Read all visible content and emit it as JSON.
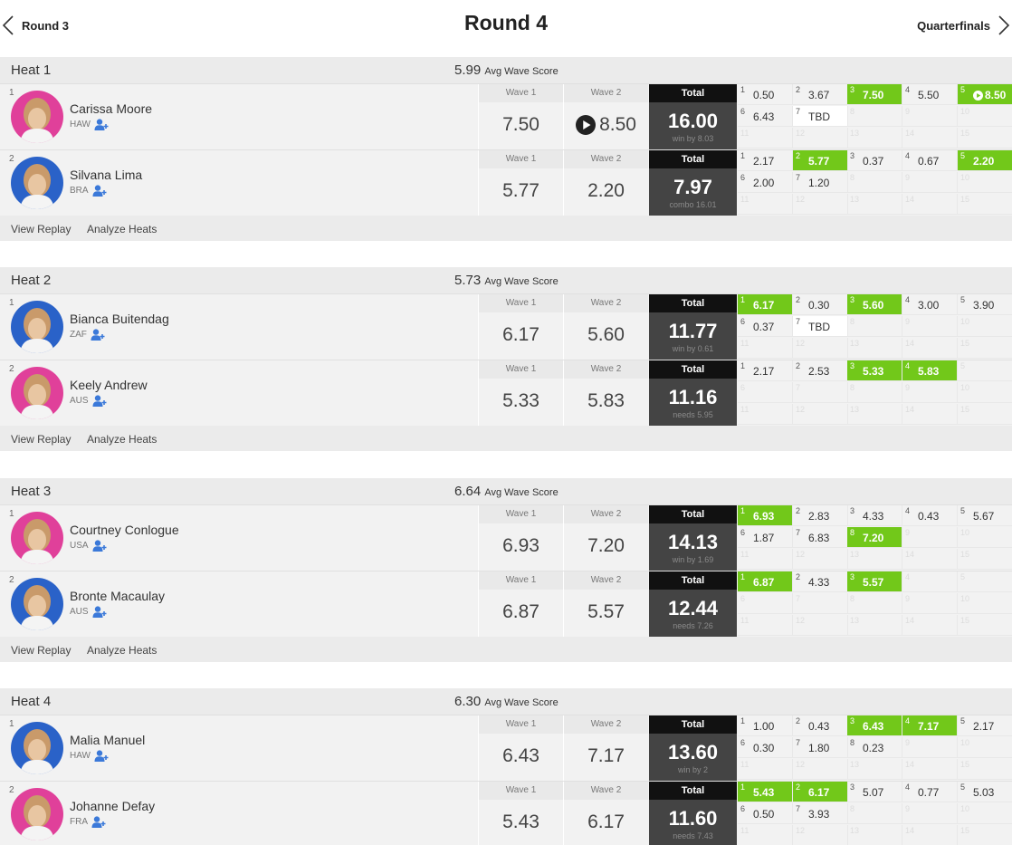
{
  "nav": {
    "prev_label": "Round 3",
    "title": "Round 4",
    "next_label": "Quarterfinals"
  },
  "labels": {
    "wave1": "Wave 1",
    "wave2": "Wave 2",
    "total": "Total",
    "avg_suffix": "Avg Wave Score",
    "view_replay": "View Replay",
    "analyze_heats": "Analyze Heats"
  },
  "colors": {
    "highlight": "#72c81a",
    "total_bg": "#444444",
    "avatar_pink": "#e0409a",
    "avatar_blue": "#2a62c8"
  },
  "heats": [
    {
      "name": "Heat 1",
      "avg": "5.99",
      "surfers": [
        {
          "seed": "1",
          "name": "Carissa Moore",
          "country": "HAW",
          "avatar_color": "pink",
          "wave1": "7.50",
          "wave2": "8.50",
          "wave2_play": true,
          "total": "16.00",
          "sub": "win by 8.03",
          "waves": [
            {
              "n": "1",
              "v": "0.50"
            },
            {
              "n": "2",
              "v": "3.67"
            },
            {
              "n": "3",
              "v": "7.50",
              "hi": true
            },
            {
              "n": "4",
              "v": "5.50"
            },
            {
              "n": "5",
              "v": "8.50",
              "hi": true,
              "play": true
            },
            {
              "n": "6",
              "v": "6.43"
            },
            {
              "n": "7",
              "v": "TBD",
              "tbd": true
            },
            {
              "n": "8",
              "v": "",
              "ghost": true
            },
            {
              "n": "9",
              "v": "",
              "ghost": true
            },
            {
              "n": "10",
              "v": "",
              "ghost": true
            },
            {
              "n": "11",
              "v": "",
              "ghost": true
            },
            {
              "n": "12",
              "v": "",
              "ghost": true
            },
            {
              "n": "13",
              "v": "",
              "ghost": true
            },
            {
              "n": "14",
              "v": "",
              "ghost": true
            },
            {
              "n": "15",
              "v": "",
              "ghost": true
            }
          ]
        },
        {
          "seed": "2",
          "name": "Silvana Lima",
          "country": "BRA",
          "avatar_color": "blue",
          "wave1": "5.77",
          "wave2": "2.20",
          "wave2_play": false,
          "total": "7.97",
          "sub": "combo 16.01",
          "waves": [
            {
              "n": "1",
              "v": "2.17"
            },
            {
              "n": "2",
              "v": "5.77",
              "hi": true
            },
            {
              "n": "3",
              "v": "0.37"
            },
            {
              "n": "4",
              "v": "0.67"
            },
            {
              "n": "5",
              "v": "2.20",
              "hi": true
            },
            {
              "n": "6",
              "v": "2.00"
            },
            {
              "n": "7",
              "v": "1.20"
            },
            {
              "n": "8",
              "v": "",
              "ghost": true
            },
            {
              "n": "9",
              "v": "",
              "ghost": true
            },
            {
              "n": "10",
              "v": "",
              "ghost": true
            },
            {
              "n": "11",
              "v": "",
              "ghost": true
            },
            {
              "n": "12",
              "v": "",
              "ghost": true
            },
            {
              "n": "13",
              "v": "",
              "ghost": true
            },
            {
              "n": "14",
              "v": "",
              "ghost": true
            },
            {
              "n": "15",
              "v": "",
              "ghost": true
            }
          ]
        }
      ]
    },
    {
      "name": "Heat 2",
      "avg": "5.73",
      "surfers": [
        {
          "seed": "1",
          "name": "Bianca Buitendag",
          "country": "ZAF",
          "avatar_color": "blue",
          "wave1": "6.17",
          "wave2": "5.60",
          "wave2_play": false,
          "total": "11.77",
          "sub": "win by 0.61",
          "waves": [
            {
              "n": "1",
              "v": "6.17",
              "hi": true
            },
            {
              "n": "2",
              "v": "0.30"
            },
            {
              "n": "3",
              "v": "5.60",
              "hi": true
            },
            {
              "n": "4",
              "v": "3.00"
            },
            {
              "n": "5",
              "v": "3.90"
            },
            {
              "n": "6",
              "v": "0.37"
            },
            {
              "n": "7",
              "v": "TBD",
              "tbd": true
            },
            {
              "n": "8",
              "v": "",
              "ghost": true
            },
            {
              "n": "9",
              "v": "",
              "ghost": true
            },
            {
              "n": "10",
              "v": "",
              "ghost": true
            },
            {
              "n": "11",
              "v": "",
              "ghost": true
            },
            {
              "n": "12",
              "v": "",
              "ghost": true
            },
            {
              "n": "13",
              "v": "",
              "ghost": true
            },
            {
              "n": "14",
              "v": "",
              "ghost": true
            },
            {
              "n": "15",
              "v": "",
              "ghost": true
            }
          ]
        },
        {
          "seed": "2",
          "name": "Keely Andrew",
          "country": "AUS",
          "avatar_color": "pink",
          "wave1": "5.33",
          "wave2": "5.83",
          "wave2_play": false,
          "total": "11.16",
          "sub": "needs 5.95",
          "waves": [
            {
              "n": "1",
              "v": "2.17"
            },
            {
              "n": "2",
              "v": "2.53"
            },
            {
              "n": "3",
              "v": "5.33",
              "hi": true
            },
            {
              "n": "4",
              "v": "5.83",
              "hi": true
            },
            {
              "n": "5",
              "v": "",
              "ghost": true
            },
            {
              "n": "6",
              "v": "",
              "ghost": true
            },
            {
              "n": "7",
              "v": "",
              "ghost": true
            },
            {
              "n": "8",
              "v": "",
              "ghost": true
            },
            {
              "n": "9",
              "v": "",
              "ghost": true
            },
            {
              "n": "10",
              "v": "",
              "ghost": true
            },
            {
              "n": "11",
              "v": "",
              "ghost": true
            },
            {
              "n": "12",
              "v": "",
              "ghost": true
            },
            {
              "n": "13",
              "v": "",
              "ghost": true
            },
            {
              "n": "14",
              "v": "",
              "ghost": true
            },
            {
              "n": "15",
              "v": "",
              "ghost": true
            }
          ]
        }
      ]
    },
    {
      "name": "Heat 3",
      "avg": "6.64",
      "surfers": [
        {
          "seed": "1",
          "name": "Courtney Conlogue",
          "country": "USA",
          "avatar_color": "pink",
          "wave1": "6.93",
          "wave2": "7.20",
          "wave2_play": false,
          "total": "14.13",
          "sub": "win by 1.69",
          "waves": [
            {
              "n": "1",
              "v": "6.93",
              "hi": true
            },
            {
              "n": "2",
              "v": "2.83"
            },
            {
              "n": "3",
              "v": "4.33"
            },
            {
              "n": "4",
              "v": "0.43"
            },
            {
              "n": "5",
              "v": "5.67"
            },
            {
              "n": "6",
              "v": "1.87"
            },
            {
              "n": "7",
              "v": "6.83"
            },
            {
              "n": "8",
              "v": "7.20",
              "hi": true
            },
            {
              "n": "9",
              "v": "",
              "ghost": true
            },
            {
              "n": "10",
              "v": "",
              "ghost": true
            },
            {
              "n": "11",
              "v": "",
              "ghost": true
            },
            {
              "n": "12",
              "v": "",
              "ghost": true
            },
            {
              "n": "13",
              "v": "",
              "ghost": true
            },
            {
              "n": "14",
              "v": "",
              "ghost": true
            },
            {
              "n": "15",
              "v": "",
              "ghost": true
            }
          ]
        },
        {
          "seed": "2",
          "name": "Bronte Macaulay",
          "country": "AUS",
          "avatar_color": "blue",
          "wave1": "6.87",
          "wave2": "5.57",
          "wave2_play": false,
          "total": "12.44",
          "sub": "needs 7.26",
          "waves": [
            {
              "n": "1",
              "v": "6.87",
              "hi": true
            },
            {
              "n": "2",
              "v": "4.33"
            },
            {
              "n": "3",
              "v": "5.57",
              "hi": true
            },
            {
              "n": "4",
              "v": "",
              "ghost": true
            },
            {
              "n": "5",
              "v": "",
              "ghost": true
            },
            {
              "n": "6",
              "v": "",
              "ghost": true
            },
            {
              "n": "7",
              "v": "",
              "ghost": true
            },
            {
              "n": "8",
              "v": "",
              "ghost": true
            },
            {
              "n": "9",
              "v": "",
              "ghost": true
            },
            {
              "n": "10",
              "v": "",
              "ghost": true
            },
            {
              "n": "11",
              "v": "",
              "ghost": true
            },
            {
              "n": "12",
              "v": "",
              "ghost": true
            },
            {
              "n": "13",
              "v": "",
              "ghost": true
            },
            {
              "n": "14",
              "v": "",
              "ghost": true
            },
            {
              "n": "15",
              "v": "",
              "ghost": true
            }
          ]
        }
      ]
    },
    {
      "name": "Heat 4",
      "avg": "6.30",
      "surfers": [
        {
          "seed": "1",
          "name": "Malia Manuel",
          "country": "HAW",
          "avatar_color": "blue",
          "wave1": "6.43",
          "wave2": "7.17",
          "wave2_play": false,
          "total": "13.60",
          "sub": "win by 2",
          "waves": [
            {
              "n": "1",
              "v": "1.00"
            },
            {
              "n": "2",
              "v": "0.43"
            },
            {
              "n": "3",
              "v": "6.43",
              "hi": true
            },
            {
              "n": "4",
              "v": "7.17",
              "hi": true
            },
            {
              "n": "5",
              "v": "2.17"
            },
            {
              "n": "6",
              "v": "0.30"
            },
            {
              "n": "7",
              "v": "1.80"
            },
            {
              "n": "8",
              "v": "0.23"
            },
            {
              "n": "9",
              "v": "",
              "ghost": true
            },
            {
              "n": "10",
              "v": "",
              "ghost": true
            },
            {
              "n": "11",
              "v": "",
              "ghost": true
            },
            {
              "n": "12",
              "v": "",
              "ghost": true
            },
            {
              "n": "13",
              "v": "",
              "ghost": true
            },
            {
              "n": "14",
              "v": "",
              "ghost": true
            },
            {
              "n": "15",
              "v": "",
              "ghost": true
            }
          ]
        },
        {
          "seed": "2",
          "name": "Johanne Defay",
          "country": "FRA",
          "avatar_color": "pink",
          "wave1": "5.43",
          "wave2": "6.17",
          "wave2_play": false,
          "total": "11.60",
          "sub": "needs 7.43",
          "waves": [
            {
              "n": "1",
              "v": "5.43",
              "hi": true
            },
            {
              "n": "2",
              "v": "6.17",
              "hi": true
            },
            {
              "n": "3",
              "v": "5.07"
            },
            {
              "n": "4",
              "v": "0.77"
            },
            {
              "n": "5",
              "v": "5.03"
            },
            {
              "n": "6",
              "v": "0.50"
            },
            {
              "n": "7",
              "v": "3.93"
            },
            {
              "n": "8",
              "v": "",
              "ghost": true
            },
            {
              "n": "9",
              "v": "",
              "ghost": true
            },
            {
              "n": "10",
              "v": "",
              "ghost": true
            },
            {
              "n": "11",
              "v": "",
              "ghost": true
            },
            {
              "n": "12",
              "v": "",
              "ghost": true
            },
            {
              "n": "13",
              "v": "",
              "ghost": true
            },
            {
              "n": "14",
              "v": "",
              "ghost": true
            },
            {
              "n": "15",
              "v": "",
              "ghost": true
            }
          ]
        }
      ]
    }
  ]
}
